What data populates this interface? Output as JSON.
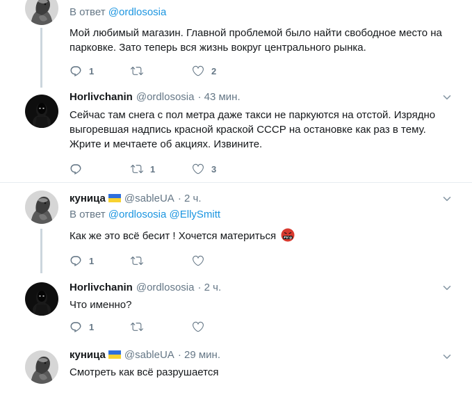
{
  "tweets": [
    {
      "reply_prefix": "В ответ ",
      "reply_to": "@ordlososia",
      "lines": [
        "Мой любимый магазин. Главной проблемой было найти свободное место на",
        "парковке. Зато теперь вся жизнь вокруг центрального рынка."
      ],
      "replies": "1",
      "retweets": "",
      "likes": "2"
    },
    {
      "name": "Horlivchanin",
      "handle": "@ordlososia",
      "time": "· 43 мин.",
      "lines": [
        "Сейчас там снега с пол метра даже такси не паркуются на отстой. Изрядно",
        "выгоревшая надпись красной краской СССР на остановке как раз в тему.",
        "Жрите и мечтаете об акциях. Извините."
      ],
      "replies": "",
      "retweets": "1",
      "likes": "3"
    },
    {
      "name": "куница",
      "handle": "@sableUA",
      "time": "· 2 ч.",
      "reply_prefix": "В ответ ",
      "reply_to": "@ordlososia @EllySmitt",
      "lines": [
        "Как же это всё бесит ! Хочется материться"
      ],
      "replies": "1",
      "retweets": "",
      "likes": ""
    },
    {
      "name": "Horlivchanin",
      "handle": "@ordlososia",
      "time": "· 2 ч.",
      "lines": [
        "Что именно?"
      ],
      "replies": "1",
      "retweets": "",
      "likes": ""
    },
    {
      "name": "куница",
      "handle": "@sableUA",
      "time": "· 29 мин.",
      "lines": [
        "Смотреть как всё разрушается"
      ]
    }
  ],
  "icons": {
    "reply": "speech-bubble-icon",
    "retweet": "retweet-arrows-icon",
    "like": "heart-icon",
    "menu": "chevron-down-icon",
    "emoji": "angry-face-symbols-emoji"
  },
  "colors": {
    "text": "#14171a",
    "muted": "#657786",
    "link": "#1b95e0",
    "divider": "#e6ecf0",
    "thread_line": "#ccd6dd"
  }
}
